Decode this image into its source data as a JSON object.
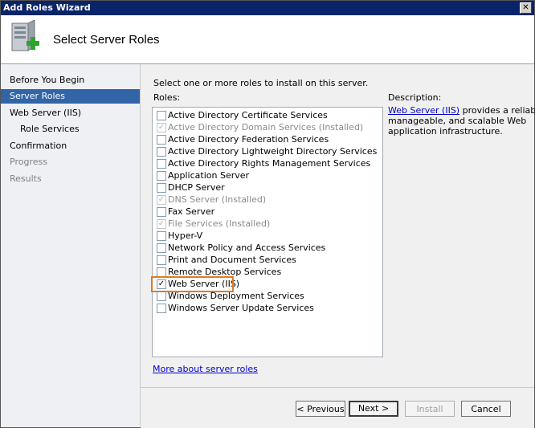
{
  "window": {
    "title": "Add Roles Wizard",
    "close_glyph": "✕"
  },
  "header": {
    "title": "Select Server Roles"
  },
  "nav": [
    {
      "label": "Before You Begin"
    },
    {
      "label": "Server Roles"
    },
    {
      "label": "Web Server (IIS)"
    },
    {
      "label": "Role Services"
    },
    {
      "label": "Confirmation"
    },
    {
      "label": "Progress"
    },
    {
      "label": "Results"
    }
  ],
  "main": {
    "instruction": "Select one or more roles to install on this server.",
    "roles_label": "Roles:",
    "roles": [
      {
        "label": "Active Directory Certificate Services",
        "checked": false,
        "installed": false
      },
      {
        "label": "Active Directory Domain Services  (Installed)",
        "checked": true,
        "installed": true
      },
      {
        "label": "Active Directory Federation Services",
        "checked": false,
        "installed": false
      },
      {
        "label": "Active Directory Lightweight Directory Services",
        "checked": false,
        "installed": false
      },
      {
        "label": "Active Directory Rights Management Services",
        "checked": false,
        "installed": false
      },
      {
        "label": "Application Server",
        "checked": false,
        "installed": false
      },
      {
        "label": "DHCP Server",
        "checked": false,
        "installed": false
      },
      {
        "label": "DNS Server  (Installed)",
        "checked": true,
        "installed": true
      },
      {
        "label": "Fax Server",
        "checked": false,
        "installed": false
      },
      {
        "label": "File Services  (Installed)",
        "checked": true,
        "installed": true
      },
      {
        "label": "Hyper-V",
        "checked": false,
        "installed": false
      },
      {
        "label": "Network Policy and Access Services",
        "checked": false,
        "installed": false
      },
      {
        "label": "Print and Document Services",
        "checked": false,
        "installed": false
      },
      {
        "label": "Remote Desktop Services",
        "checked": false,
        "installed": false
      },
      {
        "label": "Web Server (IIS)",
        "checked": true,
        "installed": false
      },
      {
        "label": "Windows Deployment Services",
        "checked": false,
        "installed": false
      },
      {
        "label": "Windows Server Update Services",
        "checked": false,
        "installed": false
      }
    ],
    "description_label": "Description:",
    "description_link": "Web Server (IIS)",
    "description_text_1": " provides a reliable,",
    "description_text_2": "manageable, and scalable Web",
    "description_text_3": "application infrastructure.",
    "more_link": "More about server roles"
  },
  "buttons": {
    "previous": "< Previous",
    "next": "Next >",
    "install": "Install",
    "cancel": "Cancel"
  },
  "check_glyph": "✓",
  "colors": {
    "title_bar": "#0a246a",
    "nav_active": "#3165a8",
    "highlight": "#e07b20",
    "link": "#0000cc"
  }
}
